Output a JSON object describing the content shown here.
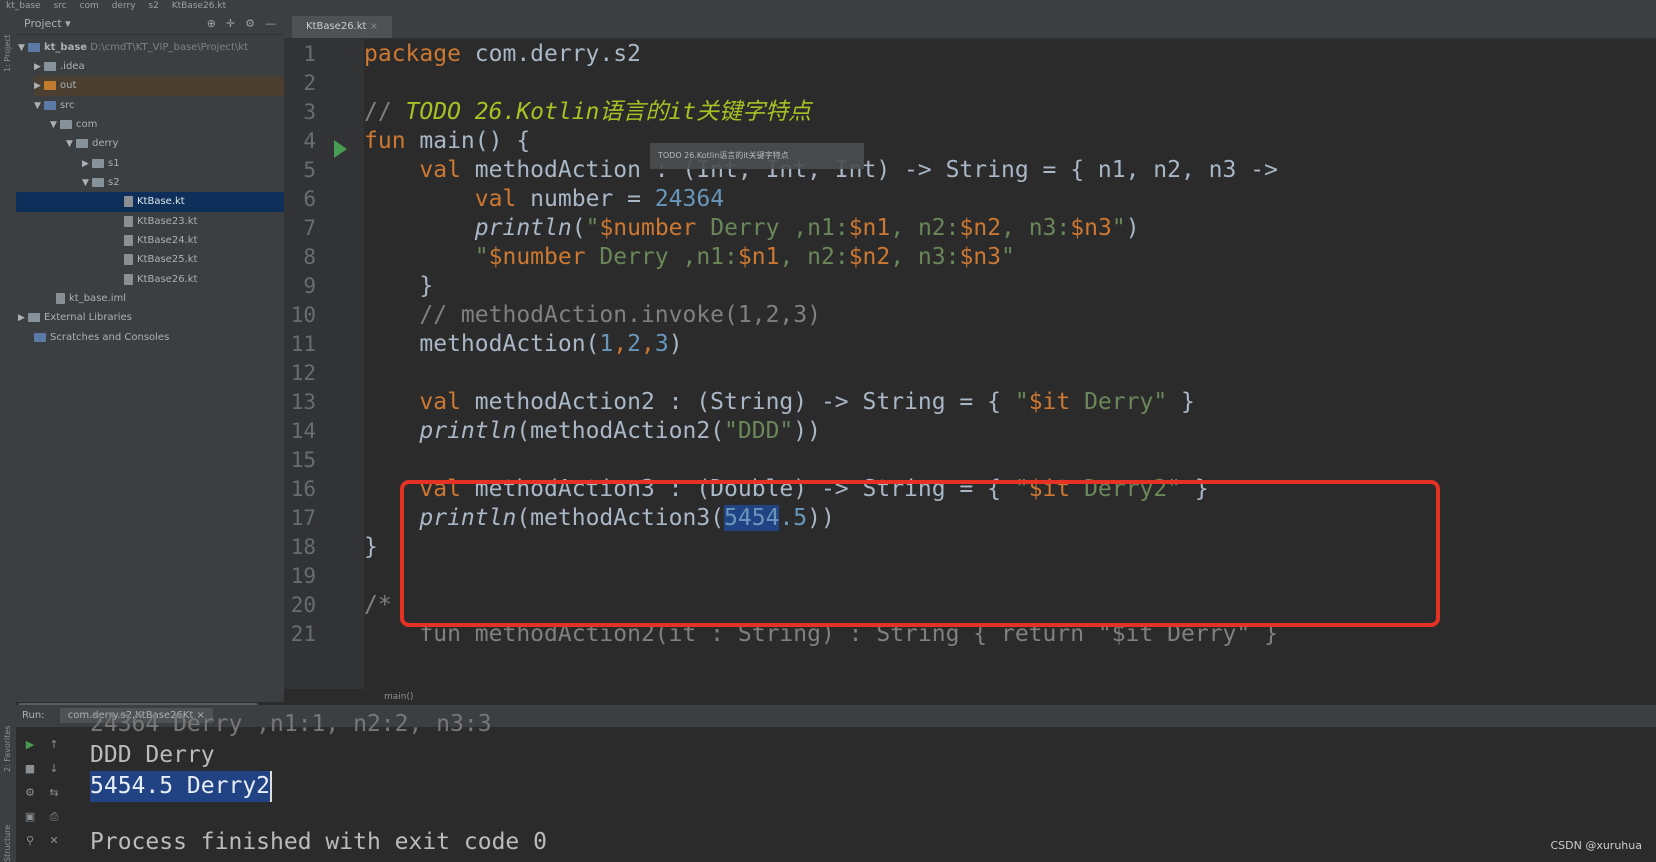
{
  "navbar": {
    "items": [
      "kt_base",
      "src",
      "com",
      "derry",
      "s2",
      "KtBase26.kt"
    ]
  },
  "sidebar_labels": {
    "project": "1: Project",
    "favorites": "2: Favorites",
    "structure": "Structure"
  },
  "project_panel": {
    "title": "Project",
    "root_label": "kt_base",
    "root_path": "D:\\cmdT\\KT_VIP_base\\Project\\kt",
    "items": {
      "idea": ".idea",
      "out": "out",
      "src": "src",
      "com": "com",
      "derry": "derry",
      "s1": "s1",
      "s2": "s2",
      "f1": "KtBase.kt",
      "f2": "KtBase23.kt",
      "f3": "KtBase24.kt",
      "f4": "KtBase25.kt",
      "f5": "KtBase26.kt",
      "iml": "kt_base.iml",
      "ext": "External Libraries",
      "scratch": "Scratches and Consoles"
    }
  },
  "editor": {
    "tab_label": "KtBase26.kt",
    "tooltip": "TODO 26.Kotlin语言的it关键字特点",
    "breadcrumb": "main()",
    "line_numbers": [
      "1",
      "2",
      "3",
      "4",
      "5",
      "6",
      "7",
      "8",
      "9",
      "10",
      "11",
      "12",
      "13",
      "14",
      "15",
      "16",
      "17",
      "18",
      "19",
      "20",
      "21"
    ],
    "code": {
      "l1_kw": "package",
      "l1_rest": " com.derry.s2",
      "l3_cmt": "// ",
      "l3_todo": "TODO 26.Kotlin语言的it关键字特点",
      "l4_kw": "fun",
      "l4_rest": " main() {",
      "l5_kw": "    val",
      "l5_rest": " methodAction : (Int, Int, Int) -> String = { n1, n2, n3 ->",
      "l6_kw": "        val",
      "l6_rest": " number = ",
      "l6_num": "24364",
      "l7_fn": "        println",
      "l7_a": "(",
      "l7_str1": "\"",
      "l7_t1": "$number",
      "l7_str2": " Derry ,n1:",
      "l7_t2": "$n1",
      "l7_str3": ", n2:",
      "l7_t3": "$n2",
      "l7_str4": ", n3:",
      "l7_t4": "$n3",
      "l7_str5": "\"",
      "l7_b": ")",
      "l8_str1": "        \"",
      "l8_t1": "$number",
      "l8_str2": " Derry ,n1:",
      "l8_t2": "$n1",
      "l8_str3": ", n2:",
      "l8_t3": "$n2",
      "l8_str4": ", n3:",
      "l8_t4": "$n3",
      "l8_str5": "\"",
      "l9": "    }",
      "l10_cmt": "    // methodAction.invoke(1,2,3)",
      "l11_a": "    methodAction(",
      "l11_n1": "1",
      "l11_c1": ",",
      "l11_n2": "2",
      "l11_c2": ",",
      "l11_n3": "3",
      "l11_b": ")",
      "l13_kw": "    val",
      "l13_rest": " methodAction2 : (String) -> String = { ",
      "l13_str1": "\"",
      "l13_t": "$it",
      "l13_str2": " Derry\"",
      "l13_end": " }",
      "l14_fn": "    println",
      "l14_a": "(methodAction2(",
      "l14_str": "\"DDD\"",
      "l14_b": "))",
      "l16_kw": "    val",
      "l16_rest": " methodAction3 : (Double) -> String = { ",
      "l16_str1": "\"",
      "l16_t": "$it",
      "l16_str2": " Derry2\"",
      "l16_end": " }",
      "l17_fn": "    println",
      "l17_a": "(methodAction3(",
      "l17_sel": "5454",
      "l17_num": ".5",
      "l17_b": "))",
      "l18": "}",
      "l20_cmt": "/*",
      "l21_cmt": "    fun methodAction2(it : String) : String { return \"$it Derry\" }"
    }
  },
  "run_panel": {
    "label": "Run:",
    "config": "com.derry.s2.KtBase26Kt",
    "lines": {
      "partial": "24364 Derry ,n1:1, n2:2, n3:3",
      "l1": "DDD Derry",
      "l2": "5454.5 Derry2",
      "l4": "Process finished with exit code 0"
    }
  },
  "watermark": "CSDN @xuruhua",
  "colors": {
    "keyword": "#cc7832",
    "string": "#6a8759",
    "number": "#6897bb",
    "todo": "#a8c023",
    "highlight_box": "#e53224"
  }
}
